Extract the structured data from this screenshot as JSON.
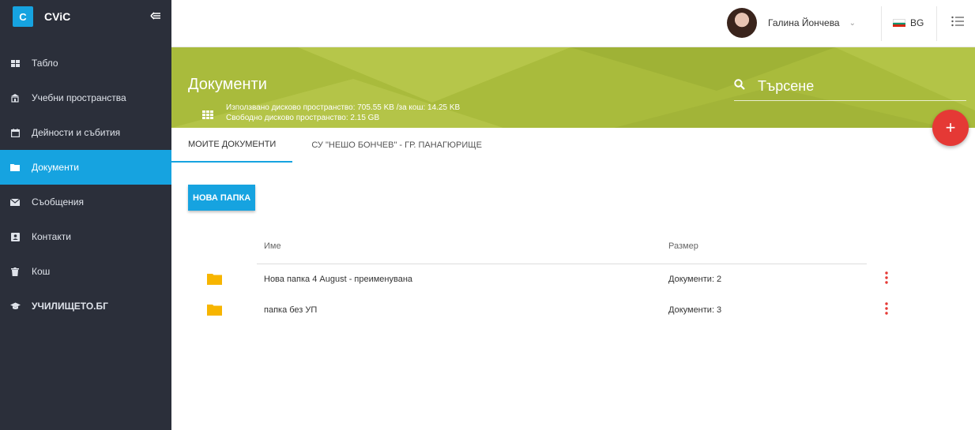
{
  "sidebar": {
    "logo_letter": "C",
    "app_name": "CViC",
    "items": [
      {
        "label": "Табло",
        "icon": "dashboard-icon"
      },
      {
        "label": "Учебни пространства",
        "icon": "classroom-icon"
      },
      {
        "label": "Дейности и събития",
        "icon": "calendar-icon"
      },
      {
        "label": "Документи",
        "icon": "folder-icon",
        "active": true
      },
      {
        "label": "Съобщения",
        "icon": "envelope-icon"
      },
      {
        "label": "Контакти",
        "icon": "contact-card-icon"
      },
      {
        "label": "Кош",
        "icon": "trash-icon"
      },
      {
        "label": "УЧИЛИЩЕТО.БГ",
        "icon": "graduation-cap-icon"
      }
    ]
  },
  "topbar": {
    "user_name": "Галина Йончева",
    "language": "BG"
  },
  "header": {
    "title": "Документи",
    "storage_used": "Използвано дисково пространство: 705.55 KB /за кош: 14.25 KB",
    "storage_free": "Свободно дисково пространство: 2.15 GB",
    "search_placeholder": "Търсене"
  },
  "tabs": [
    {
      "label": "МОИТЕ ДОКУМЕНТИ",
      "active": true
    },
    {
      "label": "СУ \"НЕШО БОНЧЕВ\" - ГР. ПАНАГЮРИЩЕ",
      "active": false
    }
  ],
  "new_folder_label": "НОВА ПАПКА",
  "table": {
    "columns": [
      "Име",
      "Размер"
    ],
    "rows": [
      {
        "name": "Нова папка 4 August - преименувана",
        "size": "Документи: 2"
      },
      {
        "name": "папка без УП",
        "size": "Документи: 3"
      }
    ]
  },
  "colors": {
    "accent": "#16a3e0",
    "header": "#a9bb3c",
    "fab": "#e53935",
    "folder": "#f7b500",
    "sidebar": "#2b2f3a"
  }
}
